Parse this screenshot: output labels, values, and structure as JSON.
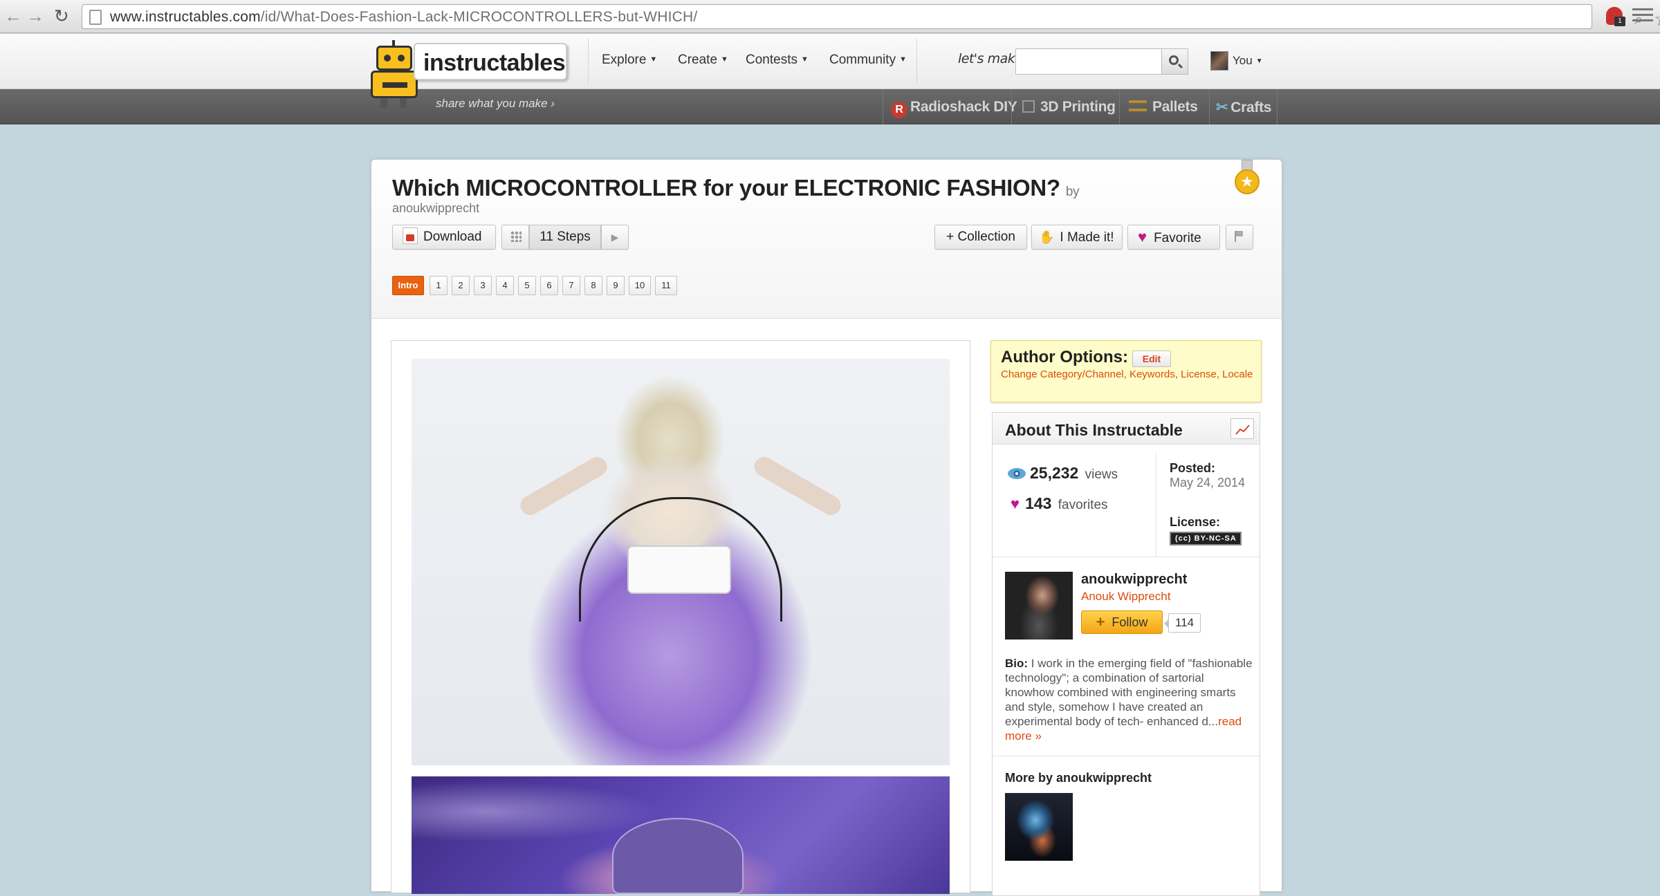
{
  "browser": {
    "url_host": "www.instructables.com",
    "url_path": "/id/What-Does-Fashion-Lack-MICROCONTROLLERS-but-WHICH/",
    "extension_badge": "1"
  },
  "header": {
    "logo_text": "instructables",
    "tagline": "share what you make ›",
    "nav": [
      "Explore",
      "Create",
      "Contests",
      "Community"
    ],
    "lets_make_label": "let's make",
    "search_placeholder": "",
    "user_label": "You",
    "channels": [
      "Radioshack DIY",
      "3D Printing",
      "Pallets",
      "Crafts"
    ]
  },
  "instructable": {
    "title": "Which MICROCONTROLLER for your ELECTRONIC FASHION?",
    "by": "by",
    "author": "anoukwipprecht",
    "download_label": "Download",
    "steps_label": "11 Steps",
    "collection_label": "+ Collection",
    "made_it_label": "I Made it!",
    "favorite_label": "Favorite",
    "step_tabs": [
      "Intro",
      "1",
      "2",
      "3",
      "4",
      "5",
      "6",
      "7",
      "8",
      "9",
      "10",
      "11"
    ]
  },
  "author_options": {
    "title": "Author Options:",
    "edit_label": "Edit",
    "links": "Change Category/Channel, Keywords, License, Locale"
  },
  "about": {
    "title": "About This Instructable",
    "views_count": "25,232",
    "views_label": "views",
    "favorites_count": "143",
    "favorites_label": "favorites",
    "posted_label": "Posted:",
    "posted_date": "May 24, 2014",
    "license_label": "License:",
    "license_badge": "BY-NC-SA",
    "author_username": "anoukwipprecht",
    "author_realname": "Anouk Wipprecht",
    "follow_label": "Follow",
    "follower_count": "114",
    "bio_label": "Bio:",
    "bio_text": " I work in the emerging field of \"fashionable technology\"; a combination of sartorial knowhow combined with engineering smarts and style, somehow I have created an experimental body of tech- enhanced d...",
    "read_more": "read more »",
    "more_by": "More by anoukwipprecht"
  },
  "colors": {
    "accent_orange": "#e8620f",
    "link_orange": "#dd4b0d",
    "favorite_pink": "#c2178a",
    "follow_yellow": "#f4a516",
    "page_bg": "#c4d6dd"
  }
}
